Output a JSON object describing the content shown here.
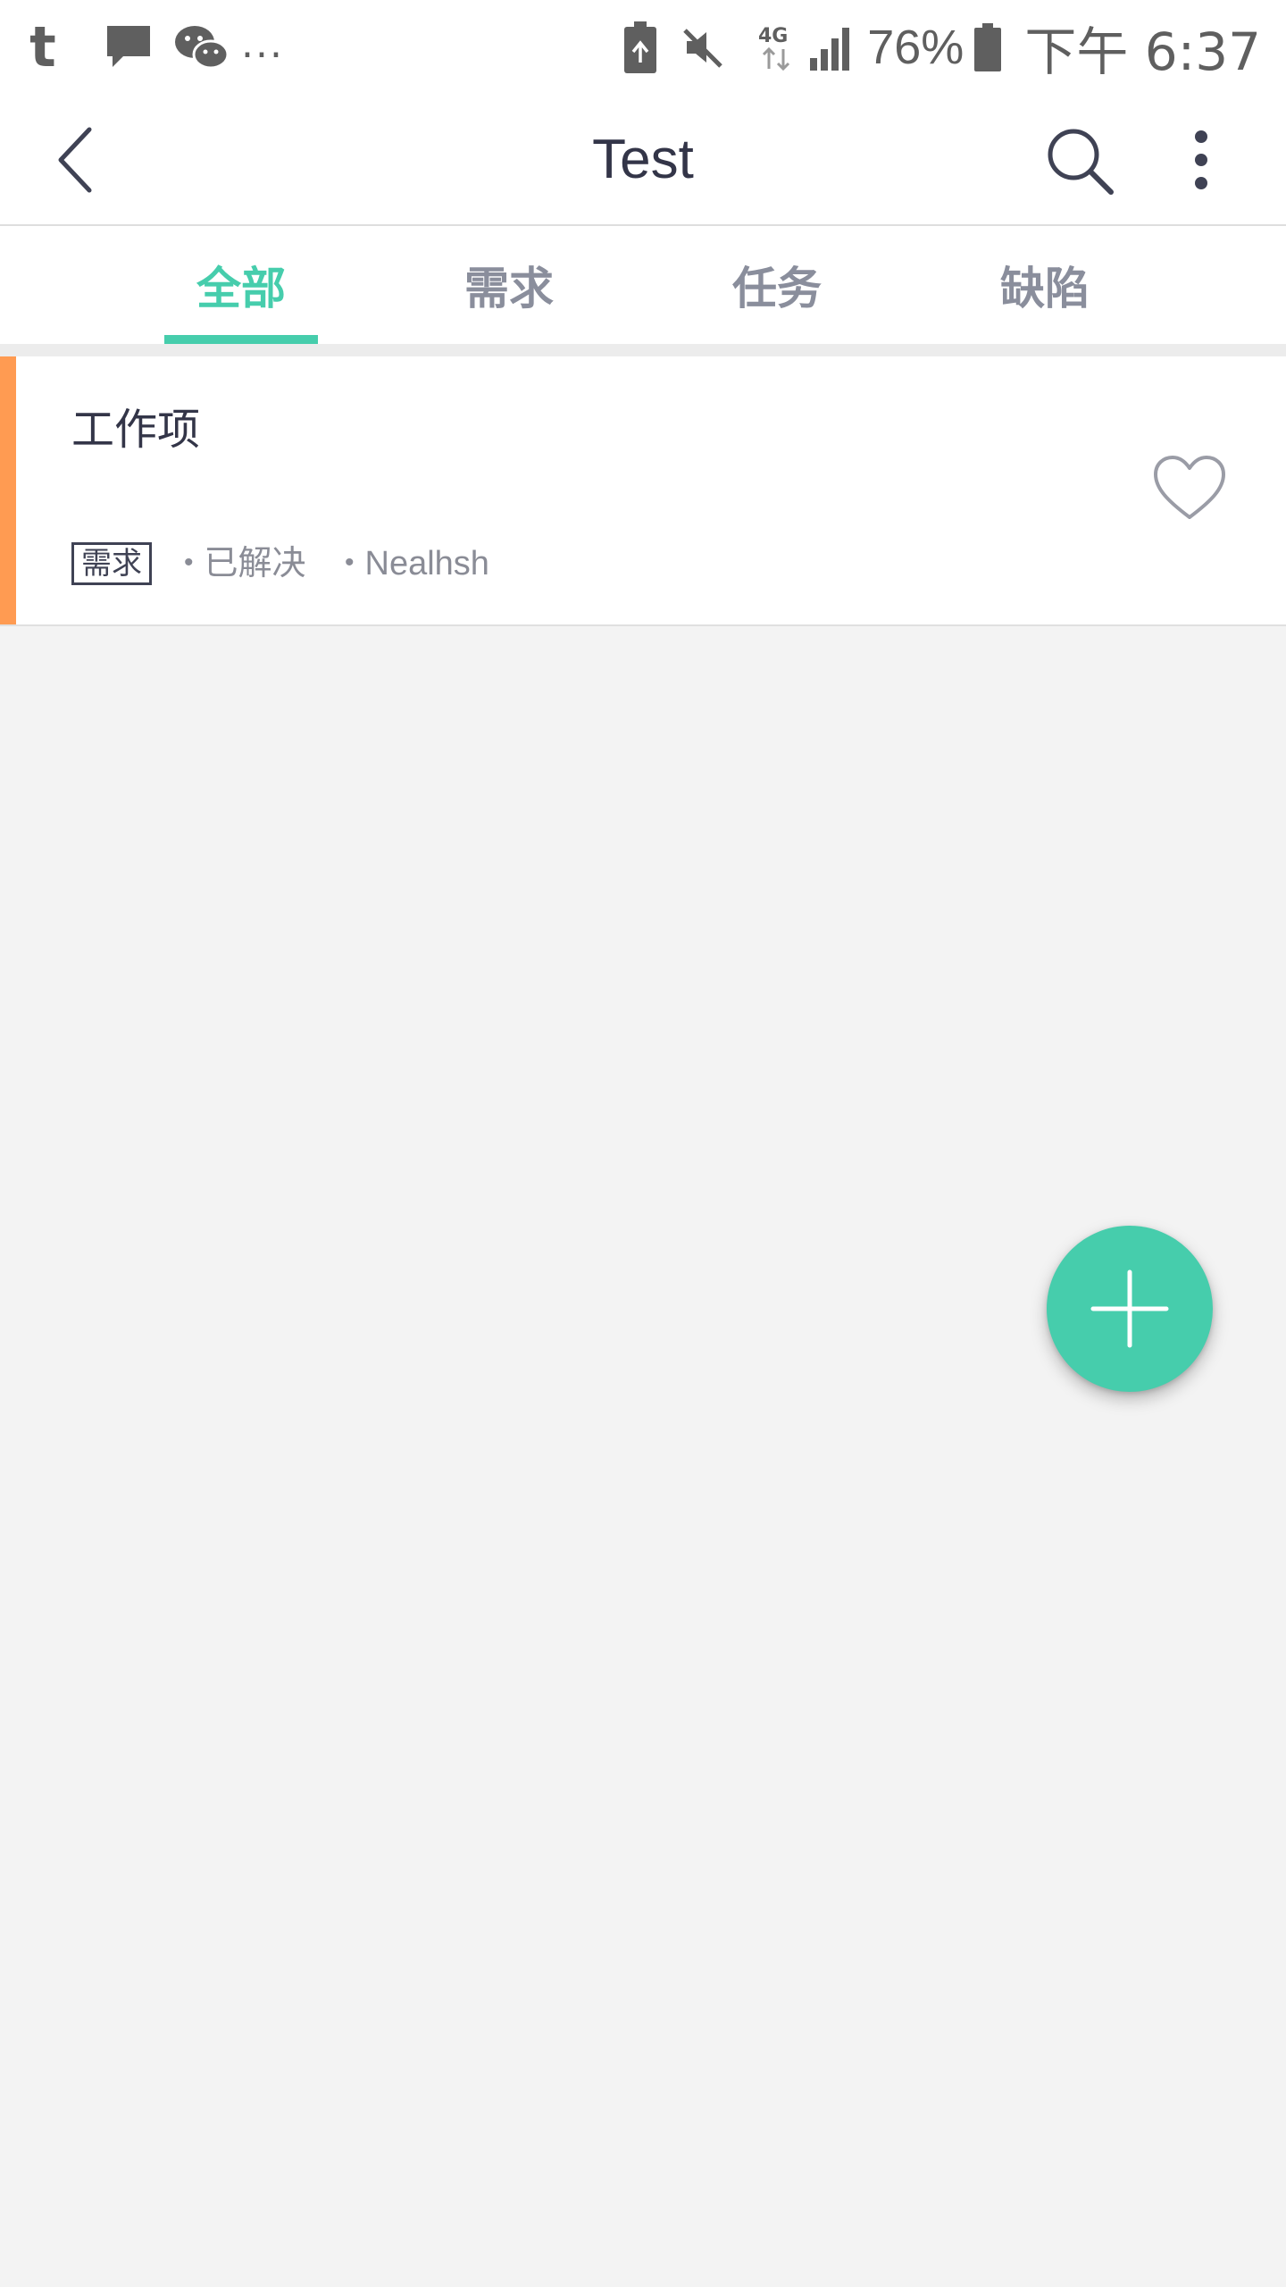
{
  "status_bar": {
    "app_letter": "t",
    "more": "...",
    "network": "4G",
    "battery_percent": "76%",
    "time": "下午 6:37"
  },
  "app_bar": {
    "title": "Test"
  },
  "tabs": [
    {
      "label": "全部",
      "active": true
    },
    {
      "label": "需求",
      "active": false
    },
    {
      "label": "任务",
      "active": false
    },
    {
      "label": "缺陷",
      "active": false
    }
  ],
  "work_items": [
    {
      "title": "工作项",
      "type_tag": "需求",
      "status": "已解决",
      "assignee": "Nealhsh",
      "priority_color": "#ff9b52"
    }
  ],
  "colors": {
    "accent": "#46cdac",
    "title_text": "#333548",
    "tab_inactive": "#8a8e9c",
    "priority_bar": "#ff9b52",
    "background": "#f3f3f3"
  },
  "icons": {
    "back": "chevron-left-icon",
    "search": "search-icon",
    "more": "more-vertical-icon",
    "favorite": "heart-outline-icon",
    "add": "plus-icon"
  }
}
